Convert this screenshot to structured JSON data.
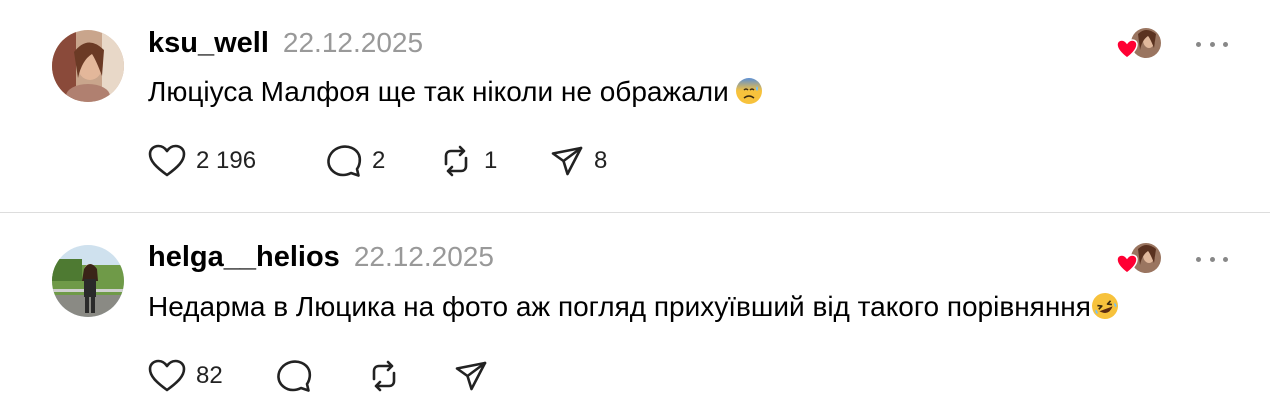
{
  "posts": [
    {
      "username": "ksu_well",
      "date": "22.12.2025",
      "text": "Люціуса Малфоя ще так ніколи не ображали",
      "text_emoji": "anxious-face-with-sweat-emoji",
      "likes": "2 196",
      "comments": "2",
      "reposts": "1",
      "shares": "8"
    },
    {
      "username": "helga__helios",
      "date": "22.12.2025",
      "text": "Недарма в Люцика на фото аж погляд прихуївший від такого порівняння",
      "text_emoji": "rolling-on-floor-laughing-emoji",
      "likes": "82",
      "comments": "",
      "reposts": "",
      "shares": ""
    }
  ],
  "icons": {
    "like": "heart-outline-icon",
    "comment": "speech-bubble-icon",
    "repost": "repost-arrows-icon",
    "share": "paper-plane-icon",
    "more": "more-dots-icon",
    "liked_by": "liked-by-author-avatar-with-heart"
  },
  "colors": {
    "text": "#000000",
    "date": "#999999",
    "heart": "#ff0033",
    "divider": "#dddddd"
  }
}
